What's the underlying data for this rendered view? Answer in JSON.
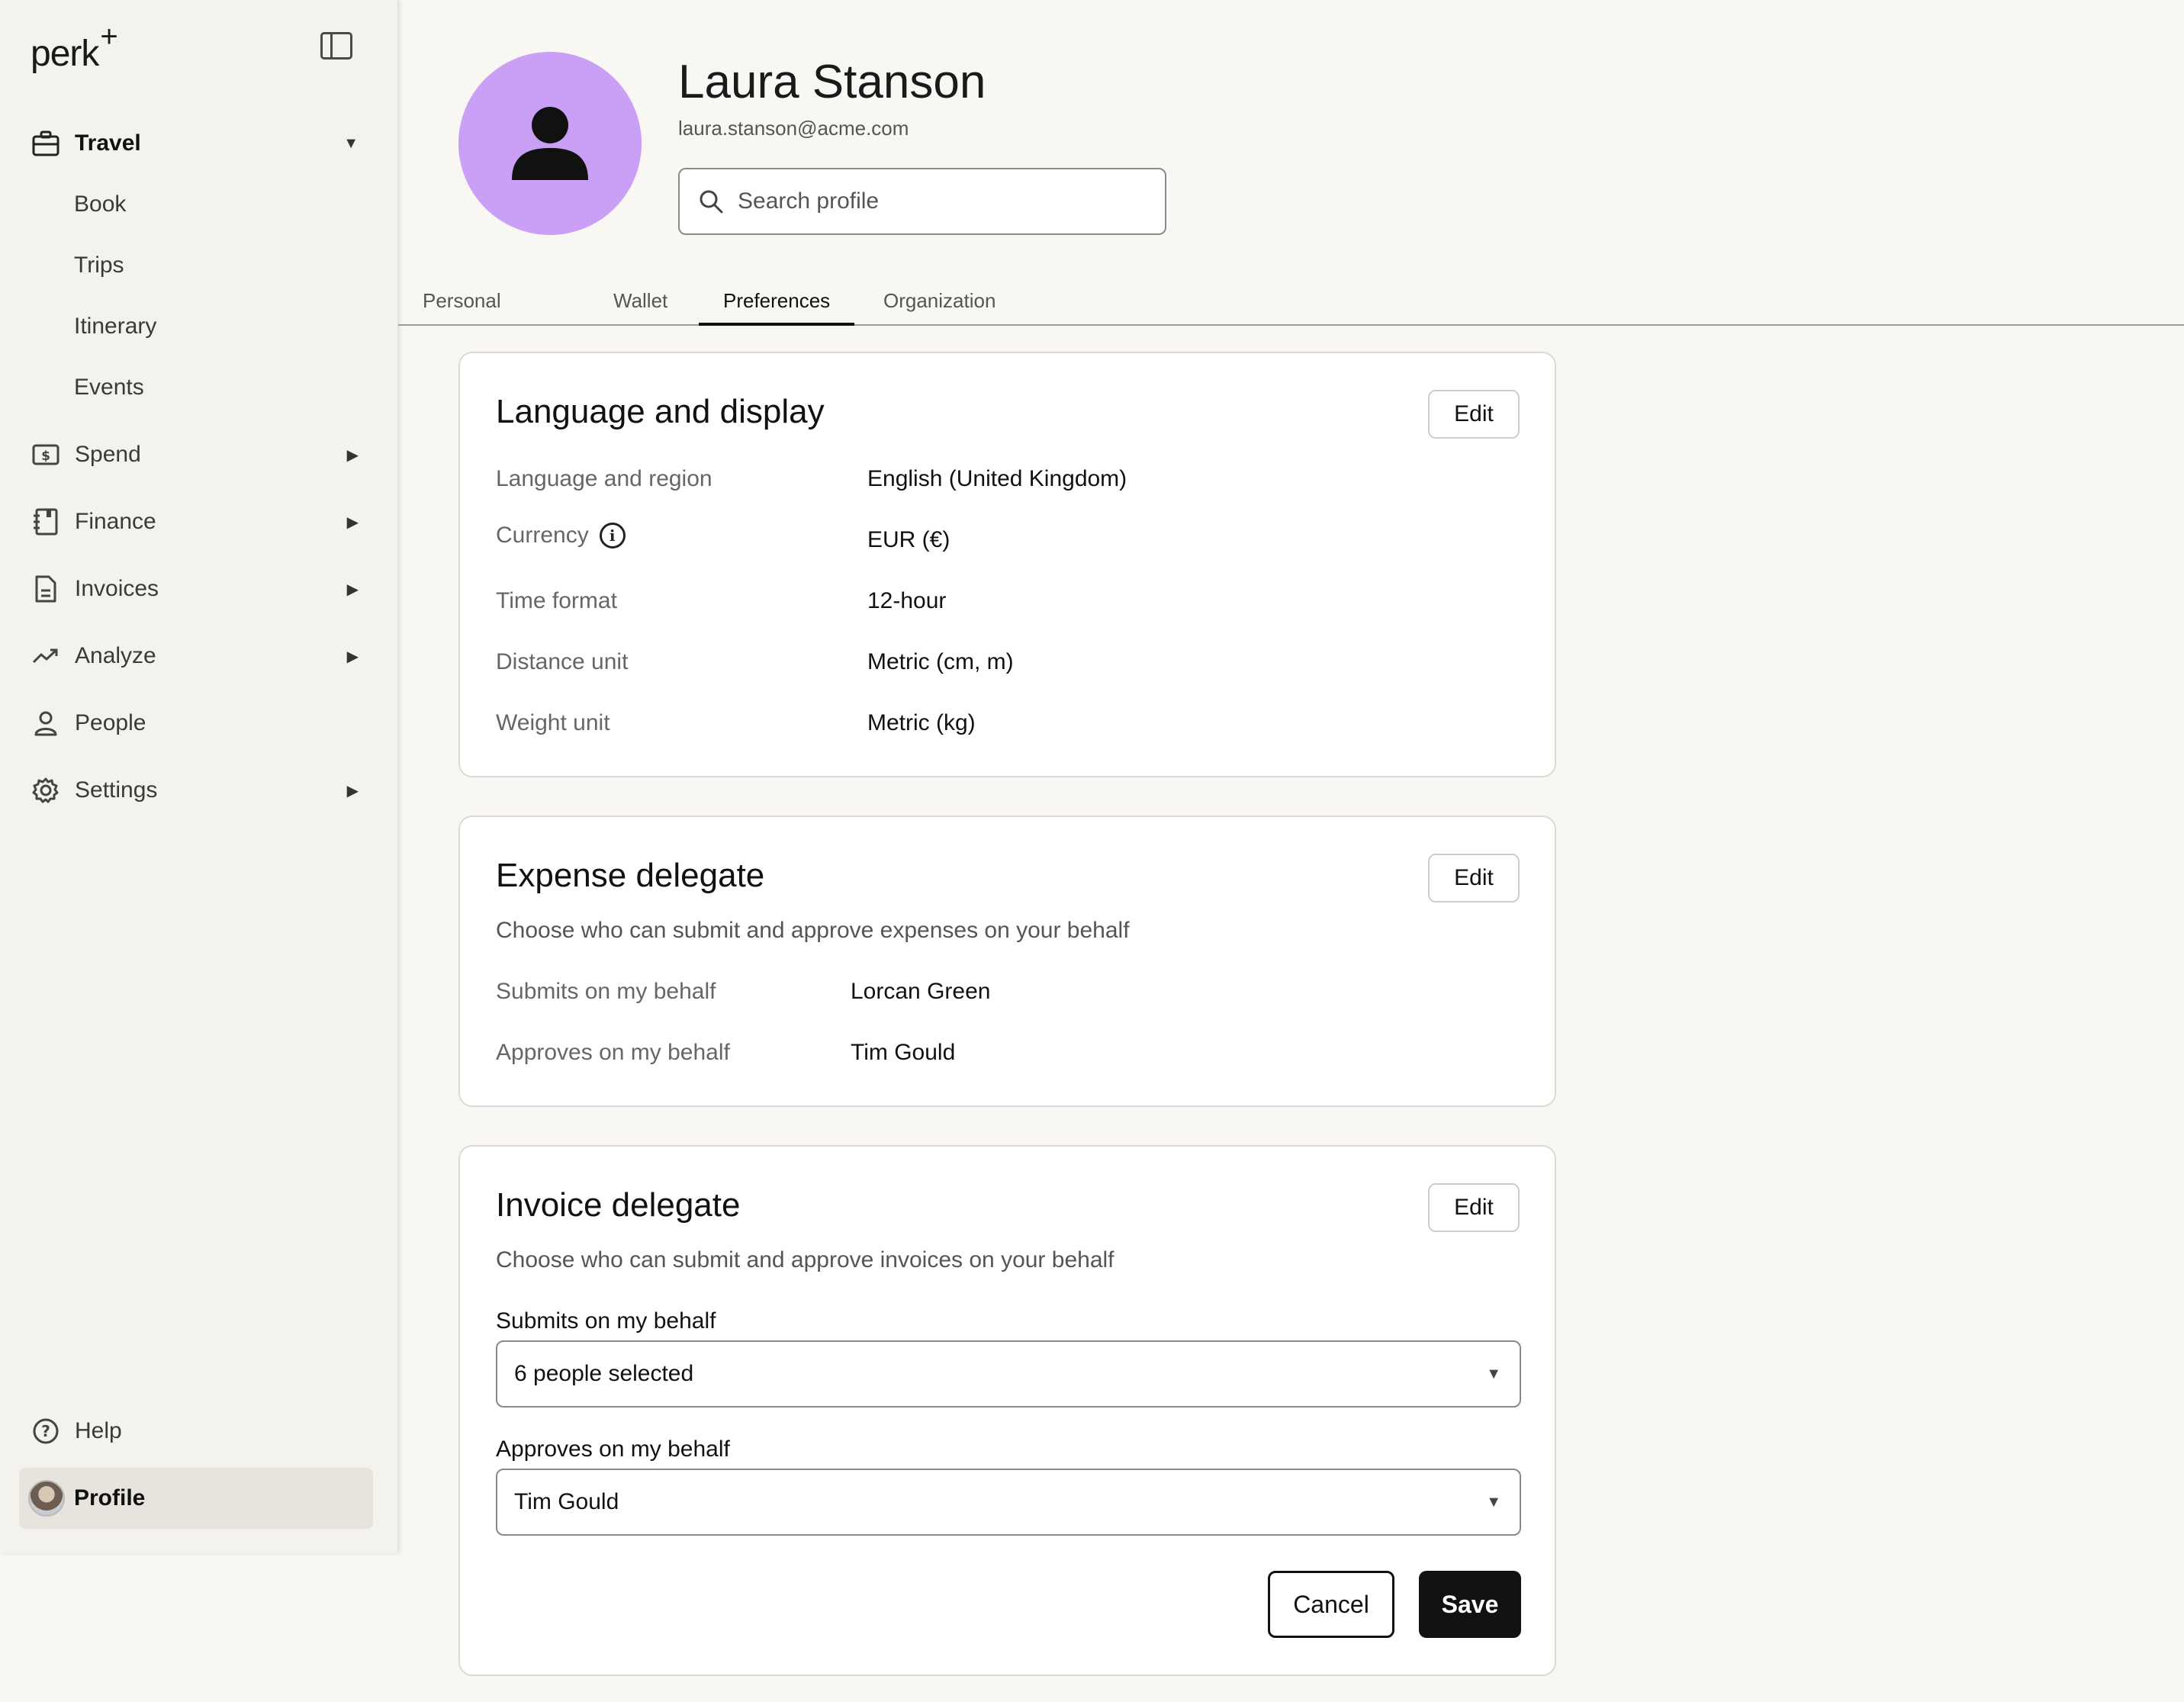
{
  "brand": {
    "logo_text": "perk",
    "logo_mark": "+"
  },
  "sidebar": {
    "sections": [
      {
        "label": "Travel",
        "icon": "briefcase-icon",
        "caret": "▼",
        "expanded": true,
        "children": [
          "Book",
          "Trips",
          "Itinerary",
          "Events"
        ]
      },
      {
        "label": "Spend",
        "icon": "cash-icon",
        "caret": "▶"
      },
      {
        "label": "Finance",
        "icon": "ledger-icon",
        "caret": "▶"
      },
      {
        "label": "Invoices",
        "icon": "document-icon",
        "caret": "▶"
      },
      {
        "label": "Analyze",
        "icon": "trend-icon",
        "caret": "▶"
      },
      {
        "label": "People",
        "icon": "person-icon"
      },
      {
        "label": "Settings",
        "icon": "gear-icon",
        "caret": "▶"
      }
    ],
    "help_label": "Help",
    "profile_label": "Profile"
  },
  "header": {
    "name": "Laura Stanson",
    "email": "laura.stanson@acme.com",
    "search_placeholder": "Search profile"
  },
  "tabs": [
    {
      "label": "Personal",
      "active": false
    },
    {
      "label": "Wallet",
      "active": false
    },
    {
      "label": "Preferences",
      "active": true
    },
    {
      "label": "Organization",
      "active": false
    }
  ],
  "language_card": {
    "title": "Language and display",
    "edit_label": "Edit",
    "rows": [
      {
        "label": "Language and region",
        "value": "English (United Kingdom)"
      },
      {
        "label": "Currency",
        "value": "EUR (€)",
        "info": "i"
      },
      {
        "label": "Time format",
        "value": "12-hour"
      },
      {
        "label": "Distance unit",
        "value": "Metric (cm, m)"
      },
      {
        "label": "Weight unit",
        "value": "Metric (kg)"
      }
    ]
  },
  "expense_card": {
    "title": "Expense delegate",
    "edit_label": "Edit",
    "description": "Choose who can submit and approve expenses on your behalf",
    "rows": [
      {
        "label": "Submits on my behalf",
        "value": "Lorcan Green"
      },
      {
        "label": "Approves on my behalf",
        "value": "Tim Gould"
      }
    ]
  },
  "invoice_card": {
    "title": "Invoice delegate",
    "edit_label": "Edit",
    "description": "Choose who can submit and approve invoices on your behalf",
    "submits_label": "Submits on my behalf",
    "submits_value": "6 people selected",
    "approves_label": "Approves on my behalf",
    "approves_value": "Tim Gould",
    "cancel_label": "Cancel",
    "save_label": "Save",
    "chevron": "▼"
  }
}
